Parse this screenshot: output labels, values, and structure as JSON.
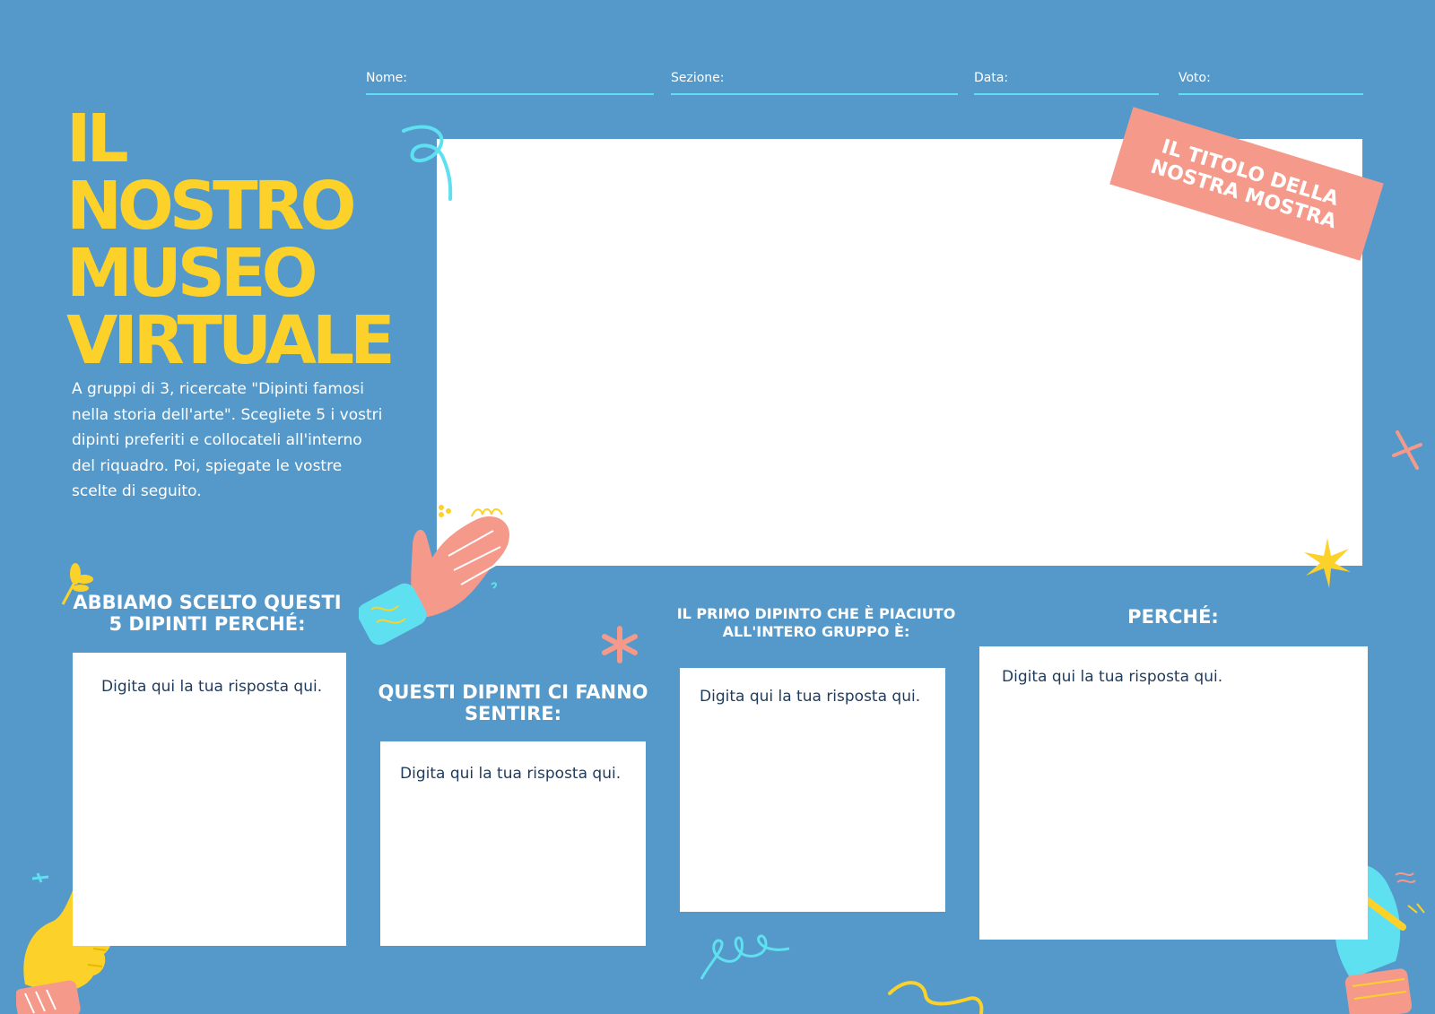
{
  "header": {
    "name_label": "Nome:",
    "section_label": "Sezione:",
    "date_label": "Data:",
    "grade_label": "Voto:"
  },
  "title": {
    "line1": "IL",
    "line2": "NOSTRO",
    "line3": "MUSEO",
    "line4": "VIRTUALE"
  },
  "intro": "A gruppi di 3, ricercate \"Dipinti famosi nella storia dell'arte\". Scegliete 5 i vostri dipinti preferiti e collocateli all'interno del riquadro. Poi, spiegate le vostre scelte di seguito.",
  "exhibit": {
    "title_tag": "IL TITOLO DELLA NOSTRA MOSTRA"
  },
  "sections": [
    {
      "heading": "ABBIAMO SCELTO QUESTI 5 DIPINTI PERCHÉ:",
      "answer": "Digita qui la tua risposta qui."
    },
    {
      "heading": "QUESTI DIPINTI CI FANNO SENTIRE:",
      "answer": "Digita qui la tua risposta qui."
    },
    {
      "heading": "IL PRIMO DIPINTO CHE È PIACIUTO ALL'INTERO GRUPPO È:",
      "answer": "Digita qui la tua risposta qui."
    },
    {
      "heading": "PERCHÉ:",
      "answer": "Digita qui la tua risposta qui."
    }
  ],
  "colors": {
    "background": "#5499c9",
    "title_yellow": "#fcd22a",
    "ribbon_salmon": "#f5998a",
    "line_cyan": "#5fe0f0",
    "answer_text": "#1f3b5c"
  }
}
